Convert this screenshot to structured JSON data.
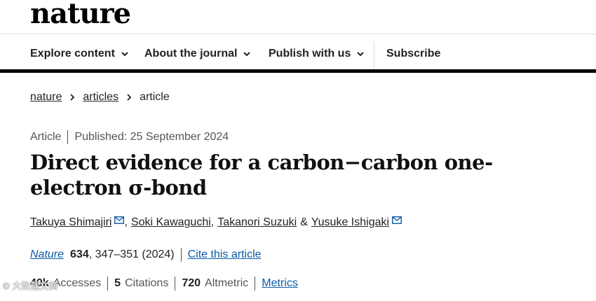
{
  "site": {
    "logo": "nature"
  },
  "nav": {
    "items": [
      {
        "label": "Explore content"
      },
      {
        "label": "About the journal"
      },
      {
        "label": "Publish with us"
      }
    ],
    "subscribe": "Subscribe"
  },
  "breadcrumb": [
    "nature",
    "articles",
    "article"
  ],
  "article": {
    "type": "Article",
    "published": "Published: 25 September 2024",
    "title": "Direct evidence for a carbon−carbon one-electron σ-bond",
    "authors": [
      {
        "name": "Takuya Shimajiri",
        "mail_icon": "envelope-icon"
      },
      {
        "name": "Soki Kawaguchi"
      },
      {
        "name": "Takanori Suzuki"
      },
      {
        "name": "Yusuke Ishigaki",
        "mail_icon": "envelope-icon"
      }
    ],
    "author_separators": [
      ",",
      ",",
      "&"
    ],
    "citation": {
      "journal": "Nature",
      "volume": "634",
      "pages": ", 347–351 (2024)",
      "cite_link": "Cite this article"
    },
    "metrics": {
      "accesses_value": "40k",
      "accesses_label": "Accesses",
      "citations_value": "5",
      "citations_label": "Citations",
      "altmetric_value": "720",
      "altmetric_label": "Altmetric",
      "metrics_link": "Metrics"
    }
  },
  "watermark": "© 大数据文摘"
}
